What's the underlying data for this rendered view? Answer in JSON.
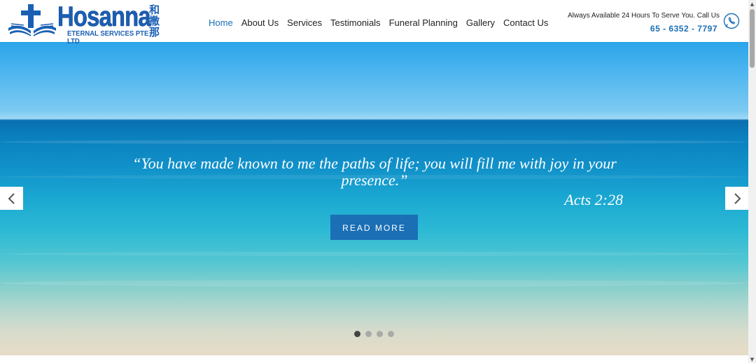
{
  "brand": {
    "name": "Hosanna",
    "subtitle": "ETERNAL SERVICES PTE LTD",
    "cjk": "和撒那"
  },
  "nav": {
    "items": [
      {
        "label": "Home"
      },
      {
        "label": "About Us"
      },
      {
        "label": "Services"
      },
      {
        "label": "Testimonials"
      },
      {
        "label": "Funeral Planning"
      },
      {
        "label": "Gallery"
      },
      {
        "label": "Contact Us"
      }
    ],
    "active_index": 0
  },
  "contact": {
    "availability": "Always Available 24 Hours To Serve You. Call Us",
    "phone": "65 - 6352 - 7797",
    "icon": "whatsapp-phone-icon"
  },
  "hero": {
    "quote": "“You have made known to me the paths of life; you will fill me with joy in your presence.”",
    "reference": "Acts 2:28",
    "button_label": "READ MORE",
    "slides_total": 4,
    "active_slide": 1,
    "prev_icon": "chevron-left-icon",
    "next_icon": "chevron-right-icon"
  },
  "colors": {
    "brand_blue": "#1a6fb5",
    "logo_blue": "#1a5fb4",
    "text_dark": "#222222"
  }
}
